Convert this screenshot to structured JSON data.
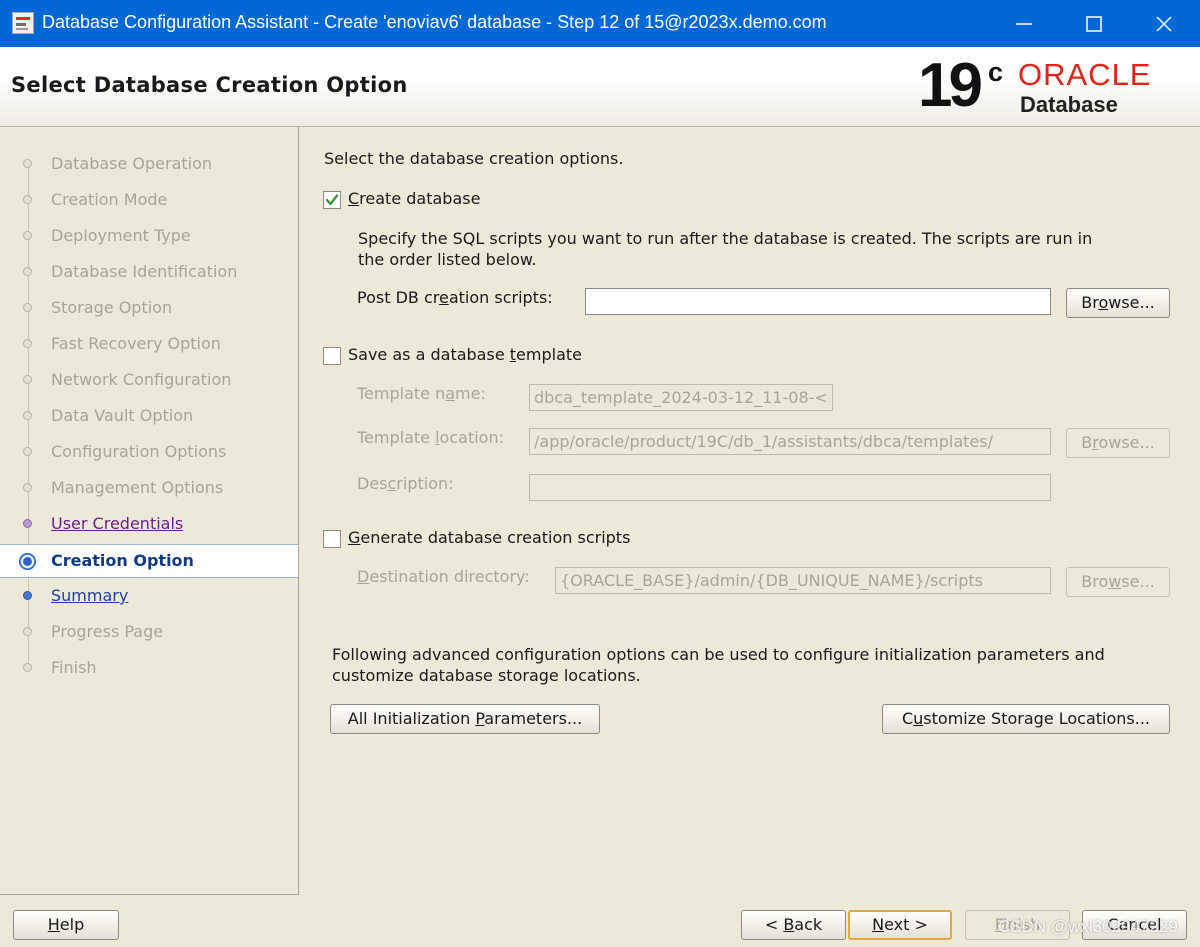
{
  "window": {
    "title": "Database Configuration Assistant - Create 'enoviav6' database - Step 12 of 15@r2023x.demo.com"
  },
  "header": {
    "page_title": "Select Database Creation Option",
    "logo_version": "19",
    "logo_sup": "c",
    "logo_brand": "ORACLE",
    "logo_product": "Database"
  },
  "nav": {
    "items": [
      {
        "label": "Database Operation",
        "state": "done"
      },
      {
        "label": "Creation Mode",
        "state": "done"
      },
      {
        "label": "Deployment Type",
        "state": "done"
      },
      {
        "label": "Database Identification",
        "state": "done"
      },
      {
        "label": "Storage Option",
        "state": "done"
      },
      {
        "label": "Fast Recovery Option",
        "state": "done"
      },
      {
        "label": "Network Configuration",
        "state": "done"
      },
      {
        "label": "Data Vault Option",
        "state": "done"
      },
      {
        "label": "Configuration Options",
        "state": "done"
      },
      {
        "label": "Management Options",
        "state": "done"
      },
      {
        "label": "User Credentials",
        "state": "visited"
      },
      {
        "label": "Creation Option",
        "state": "current"
      },
      {
        "label": "Summary",
        "state": "next"
      },
      {
        "label": "Progress Page",
        "state": "pending"
      },
      {
        "label": "Finish",
        "state": "pending"
      }
    ]
  },
  "main": {
    "intro": "Select the database creation options.",
    "create_db": {
      "label_pre": "",
      "label_u": "C",
      "label_post": "reate database",
      "checked": true,
      "desc_line1": "Specify the SQL scripts you want to run after the database is created. The scripts are run in",
      "desc_line2": "the order listed below.",
      "post_scripts_pre": "Post DB cr",
      "post_scripts_u": "e",
      "post_scripts_post": "ation scripts:",
      "post_scripts_value": "",
      "browse_pre": "Br",
      "browse_u": "o",
      "browse_post": "wse..."
    },
    "template": {
      "label_pre": "Save as a database ",
      "label_u": "t",
      "label_post": "emplate",
      "checked": false,
      "name_label_pre": "Template n",
      "name_label_u": "a",
      "name_label_post": "me:",
      "name_value": "dbca_template_2024-03-12_11-08-<",
      "location_label_pre": "Template ",
      "location_label_u": "l",
      "location_label_post": "ocation:",
      "location_value": "/app/oracle/product/19C/db_1/assistants/dbca/templates/",
      "browse_pre": "B",
      "browse_u": "r",
      "browse_post": "owse...",
      "desc_label_pre": "Des",
      "desc_label_u": "c",
      "desc_label_post": "ription:",
      "desc_value": ""
    },
    "scripts": {
      "label_pre": "",
      "label_u": "G",
      "label_post": "enerate database creation scripts",
      "checked": false,
      "dest_label_pre": "",
      "dest_label_u": "D",
      "dest_label_post": "estination directory:",
      "dest_value": "{ORACLE_BASE}/admin/{DB_UNIQUE_NAME}/scripts",
      "browse_pre": "Bro",
      "browse_u": "w",
      "browse_post": "se..."
    },
    "advanced_line1": "Following advanced configuration options can be used to configure initialization parameters and",
    "advanced_line2": "customize database storage locations.",
    "init_params_pre": "All Initialization ",
    "init_params_u": "P",
    "init_params_post": "arameters...",
    "storage_pre": "C",
    "storage_u": "u",
    "storage_post": "stomize Storage Locations..."
  },
  "footer": {
    "help_u": "H",
    "help_post": "elp",
    "back_pre": "< ",
    "back_u": "B",
    "back_post": "ack",
    "next_u": "N",
    "next_post": "ext >",
    "finish_u": "F",
    "finish_post": "inish",
    "cancel": "Cancel",
    "watermark": "CSDN @wxl302947229"
  },
  "colors": {
    "titlebar": "#0068d6",
    "oracle_red": "#e2231a",
    "panel_bg": "#ece9d8",
    "visited_link": "#6a1f8a",
    "next_link": "#1f3ea8",
    "default_button_border": "#e2a93d"
  },
  "icons": {
    "app": "dbca-app-icon",
    "minimize": "minimize-icon",
    "maximize": "maximize-icon",
    "close": "close-icon",
    "check": "checkmark-icon"
  }
}
